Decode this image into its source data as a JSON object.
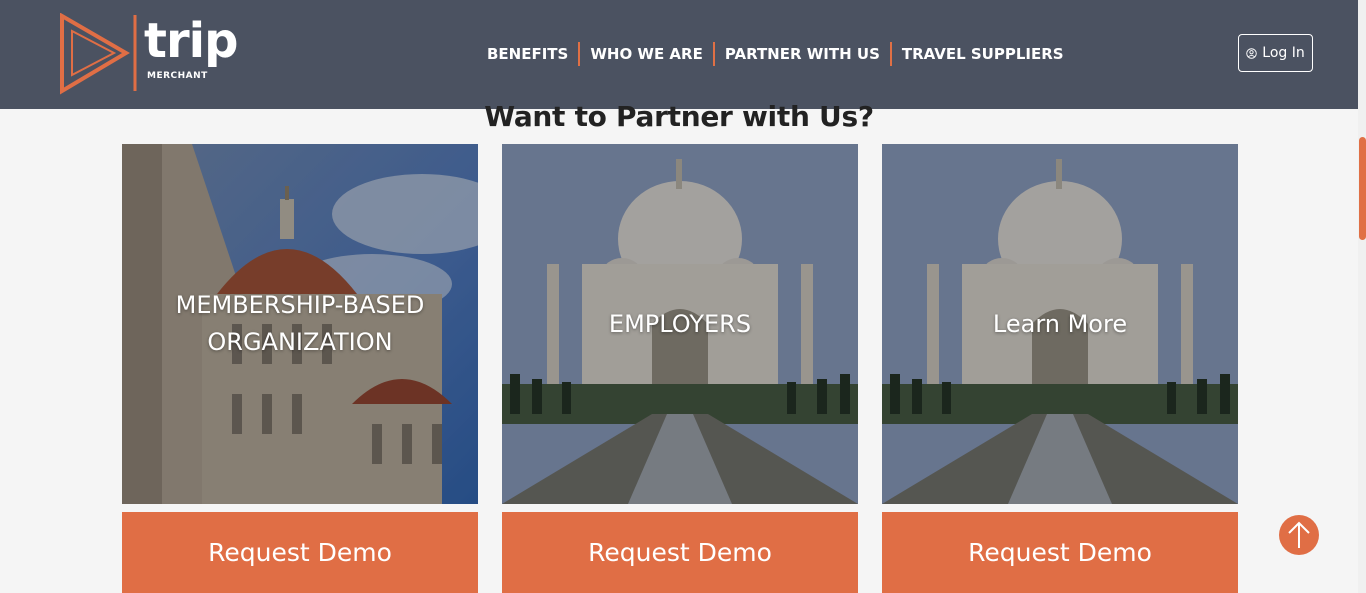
{
  "brand": {
    "name": "trip",
    "subtitle": "MERCHANT",
    "accent": "#e06e45"
  },
  "nav": {
    "items": [
      "BENEFITS",
      "WHO WE ARE",
      "PARTNER WITH US",
      "TRAVEL SUPPLIERS"
    ]
  },
  "header": {
    "login_label": "Log In",
    "login_icon": "user-circle-icon"
  },
  "section": {
    "title": "Want to Partner with Us?"
  },
  "cards": [
    {
      "line1": "MEMBERSHIP-BASED",
      "line2": "ORGANIZATION",
      "image": "florence-cathedral-photo",
      "button": "Request Demo"
    },
    {
      "line1": "EMPLOYERS",
      "line2": "",
      "image": "taj-mahal-photo",
      "button": "Request Demo"
    },
    {
      "line1": "Learn More",
      "line2": "",
      "image": "taj-mahal-photo",
      "button": "Request Demo"
    }
  ],
  "scroll_top": {
    "icon": "arrow-up-icon"
  }
}
